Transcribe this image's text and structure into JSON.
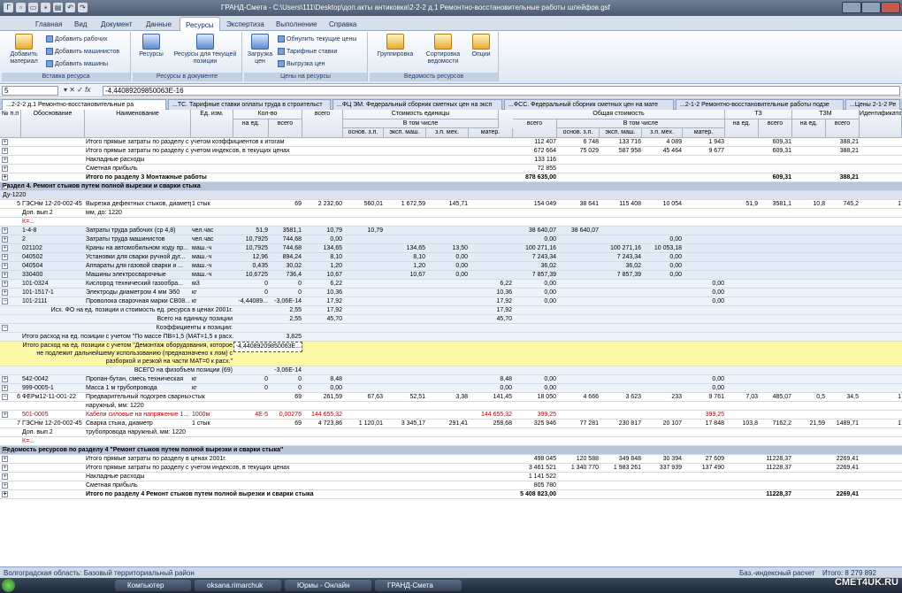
{
  "app": {
    "title": "ГРАНД-Смета - C:\\Users\\111\\Desktop\\доп.акты антиковка\\2-2-2 д.1 Ремонтно-восстановительные работы шлейфов.gsf"
  },
  "menu": [
    "Главная",
    "Вид",
    "Документ",
    "Данные",
    "Ресурсы",
    "Экспертиза",
    "Выполнение",
    "Справка"
  ],
  "ribbon": {
    "add_material": "Добавить материал",
    "add_workers": "Добавить рабочих",
    "add_machinists": "Добавить машинистов",
    "add_machines": "Добавить машины",
    "resources": "Ресурсы",
    "resources_current": "Ресурсы для текущей позиции",
    "load_prices": "Загрузка цен",
    "reset_prices": "Обнулить текущие цены",
    "tariff_rates": "Тарифные ставки",
    "unload_prices": "Выгрузка цен",
    "grouping": "Группировка",
    "sort_list": "Сортировка ведомости",
    "options": "Опции",
    "groups": [
      "Вставка ресурса",
      "Ресурсы в документе",
      "Цены на ресурсы",
      "Ведомость ресурсов"
    ]
  },
  "formula": {
    "cell": "5",
    "value": "-4,44089209850063E-16"
  },
  "tabs": [
    "...2-2-2 д.1 Ремонтно-восстановительные ра",
    "...ТС. Тарифные ставки оплаты труда в строительст",
    "...ФЦ ЭМ. Федеральный сборник сметных цен на эксп",
    "...ФСС. Федеральный сборник сметных цен на мате",
    "...2-1-2 Ремонтно-восстановительные работы подзе",
    "...Цены 2-1-2 Ре"
  ],
  "headers": {
    "num": "№ п.п",
    "basis": "Обоснование",
    "name": "Наименование",
    "unit": "Ед. изм.",
    "qty": "Кол-во",
    "qty_unit": "на ед.",
    "qty_total": "всего",
    "unit_cost": "Стоимость единицы",
    "total_cost_left": "всего",
    "incl": "В том числе",
    "osn_zp": "основ. з.п.",
    "eksp": "эксп. маш.",
    "zp_mekh": "з.п. мех.",
    "mater": "матер.",
    "total_cost": "Общая стоимость",
    "tc_total": "всего",
    "tc_zp": "основ. з.п.",
    "tc_eksp": "эксп. маш.",
    "tc_zpm": "з.п. мех.",
    "tc_mat": "матер.",
    "tz": "ТЗ",
    "tz_unit": "на ед.",
    "tz_total": "всего",
    "tzm": "ТЗМ",
    "tzm_unit": "на ед.",
    "tzm_total": "всего",
    "ident": "Идентификатор"
  },
  "rows": [
    {
      "t": "",
      "tg": "+",
      "name": "Итого прямые затраты по разделу с учетом коэффициентов к итогам",
      "tc": "112 407",
      "z": "6 748",
      "e": "133 716",
      "zm": "4 089",
      "m": "1 943",
      "tzt": "609,31",
      "tzmt": "388,21"
    },
    {
      "t": "",
      "tg": "+",
      "name": "Итого прямые затраты по разделу с учетом индексов, в текущих ценах",
      "tc": "672 664",
      "z": "75 029",
      "e": "587 958",
      "zm": "45 464",
      "m": "9 677",
      "tzt": "609,31",
      "tzmt": "388,21"
    },
    {
      "t": "",
      "tg": "+",
      "name": "Накладные расходы",
      "tc": "133 116"
    },
    {
      "t": "",
      "tg": "+",
      "name": "Сметная прибыль",
      "tc": "72 855"
    },
    {
      "t": "bold",
      "tg": "+",
      "name": "Итого по разделу 3 Монтажные  работы",
      "tc": "878 635,00",
      "tzt": "609,31",
      "tzmt": "388,21"
    },
    {
      "t": "sec",
      "tg": "-",
      "name": "Раздел 4. Ремонт стыков  путем полной вырезки и сварки стыка"
    },
    {
      "t": "sub",
      "name": "Ду-1220"
    },
    {
      "t": "",
      "num": "5",
      "basis": "ГЭСНм 12-20-002-45",
      "name": "Вырезка дефектных стыков, диаметр трубопровода наружный,",
      "unit": "1 стык",
      "qt": "69",
      "total": "2 232,60",
      "osn": "560,01",
      "eks": "1 672,59",
      "zm1": "145,71",
      "tc": "154 049",
      "z": "38 641",
      "e": "115 408",
      "zm": "10 054",
      "tzu": "51,9",
      "tzt": "3581,1",
      "tzmu": "10,8",
      "tzmt": "745,2",
      "id": "1"
    },
    {
      "t": "",
      "basis": "Доп. вып.2",
      "name": "мм, до: 1220"
    },
    {
      "t": "red",
      "basis": "К=..."
    },
    {
      "t": "blue",
      "tg": "+",
      "basis": "1-4-8",
      "name": "Затраты труда рабочих (ср 4,8)",
      "unit": "чел.час",
      "qu": "51,9",
      "qt": "3581,1",
      "total": "10,79",
      "osn": "10,79",
      "tc": "38 640,07",
      "z": "38 640,07"
    },
    {
      "t": "blue",
      "tg": "+",
      "basis": "2",
      "name": "Затраты труда машинистов",
      "unit": "чел.час",
      "qu": "10,7925",
      "qt": "744,68",
      "total": "0,00",
      "tc": "0,00",
      "zm": "0,00"
    },
    {
      "t": "blue",
      "tg": "+",
      "basis": "021102",
      "name": "Краны на автомобильном ходу пр...",
      "unit": "маш.-ч",
      "qu": "10,7925",
      "qt": "744,68",
      "total": "134,65",
      "eks": "134,65",
      "zm1": "13,50",
      "tc": "100 271,16",
      "e": "100 271,16",
      "zm": "10 053,18"
    },
    {
      "t": "blue",
      "tg": "+",
      "basis": "040502",
      "name": "Установки для сварки ручной дуг...",
      "unit": "маш.-ч",
      "qu": "12,96",
      "qt": "894,24",
      "total": "8,10",
      "eks": "8,10",
      "zm1": "0,00",
      "tc": "7 243,34",
      "e": "7 243,34",
      "zm": "0,00"
    },
    {
      "t": "blue",
      "tg": "+",
      "basis": "040504",
      "name": "Аппараты для газовой сварки и ...",
      "unit": "маш.-ч",
      "qu": "0,435",
      "qt": "30,02",
      "total": "1,20",
      "eks": "1,20",
      "zm1": "0,00",
      "tc": "36,02",
      "e": "36,02",
      "zm": "0,00"
    },
    {
      "t": "blue",
      "tg": "+",
      "basis": "330400",
      "name": "Машины электросварочные",
      "unit": "маш.-ч",
      "qu": "10,6725",
      "qt": "736,4",
      "total": "10,67",
      "eks": "10,67",
      "zm1": "0,00",
      "tc": "7 857,39",
      "e": "7 857,39",
      "zm": "0,00"
    },
    {
      "t": "lb",
      "tg": "+",
      "basis": "101-0324",
      "name": "Кислород технический газообра...",
      "unit": "м3",
      "qu": "0",
      "qt": "0",
      "total": "6,22",
      "m1": "6,22",
      "tc": "0,00",
      "m": "0,00"
    },
    {
      "t": "lb",
      "tg": "+",
      "basis": "101-1517-1",
      "name": "Электроды диаметром 4 мм Э50",
      "unit": "кг",
      "qu": "0",
      "qt": "0",
      "total": "10,36",
      "m1": "10,36",
      "tc": "0,00",
      "m": "0,00"
    },
    {
      "t": "lb",
      "tg": "-",
      "basis": "101-2111",
      "name": "Проволока сварочная марки СВ08...",
      "unit": "кг",
      "qu": "-4,44089...",
      "qt": "-3,06E-14",
      "total": "17,92",
      "m1": "17,92",
      "tc": "0,00",
      "m": "0,00"
    },
    {
      "t": "lb",
      "basis": "Исх. ФО на ед. позиции и стоимость ед. ресурса в ценах 2001г.",
      "qt": "2,55",
      "total": "17,92",
      "m1": "17,92"
    },
    {
      "t": "lb",
      "name": "Всего на единицу позиции",
      "qt": "2,55",
      "total": "45,70",
      "m1": "45,70"
    },
    {
      "t": "lb",
      "tg": "-",
      "name": "Коэффициенты к позиции:"
    },
    {
      "t": "lb",
      "name": "Итого расход на ед. позиции с учетом \"По массе ПВ=1,5 (МАТ=1,5 к расх.)\"",
      "qt": "3,825"
    },
    {
      "t": "yellow",
      "name": "Итого расход на ед. позиции с учетом \"Демонтаж оборудования, которое не подлежит дальнейшему использованию (предназначено к лом) с разборкой и резкой на части МАТ=0 к расх.\"",
      "qu": "-4,44089209850063E..."
    },
    {
      "t": "lb",
      "name": "ВСЕГО на физобъем позиции (69)",
      "qt": "-3,06E-14"
    },
    {
      "t": "lb",
      "tg": "+",
      "basis": "542-0042",
      "name": "Пропан-бутан, смесь техническая",
      "unit": "кг",
      "qu": "0",
      "qt": "0",
      "total": "8,48",
      "m1": "8,48",
      "tc": "0,00",
      "m": "0,00"
    },
    {
      "t": "lb",
      "tg": "+",
      "basis": "999-0005-1",
      "name": "Масса 1 м трубопровода",
      "unit": "кг",
      "qu": "0",
      "qt": "0",
      "total": "0,00",
      "m1": "0,00",
      "tc": "0,00",
      "m": "0,00"
    },
    {
      "t": "",
      "tg": "-",
      "num": "6",
      "basis": "ФЕРм12-11-001-22",
      "name": "Предварительный подогрев сварных соединений труб. Диаметр",
      "unit": "стык",
      "qt": "69",
      "total": "261,59",
      "osn": "67,63",
      "eks": "52,51",
      "zm1": "3,38",
      "m1": "141,45",
      "tc": "18 050",
      "z": "4 666",
      "e": "3 623",
      "zm": "233",
      "m": "9 761",
      "tzu": "7,03",
      "tzt": "485,07",
      "tzmu": "0,5",
      "tzmt": "34,5",
      "id": "1"
    },
    {
      "t": "",
      "name": "наружный, мм: 1220"
    },
    {
      "t": "red",
      "tg": "+",
      "basis": "501-0005",
      "name": "Кабели силовые на напряжение 1...",
      "unit": "1000м",
      "qu": "4E-5",
      "qt": "0,00276",
      "total": "144 655,32",
      "m1": "144 655,32",
      "tc": "399,25",
      "m": "399,25"
    },
    {
      "t": "",
      "num": "7",
      "basis": "ГЭСНм 12-20-002-45",
      "name": "Сварка стыка, диаметр",
      "unit": "1 стык",
      "qt": "69",
      "total": "4 723,86",
      "osn": "1 120,01",
      "eks": "3 345,17",
      "zm1": "291,41",
      "m1": "258,68",
      "tc": "325 946",
      "z": "77 281",
      "e": "230 817",
      "zm": "20 107",
      "m": "17 848",
      "tzu": "103,8",
      "tzt": "7162,2",
      "tzmu": "21,59",
      "tzmt": "1489,71",
      "id": "1"
    },
    {
      "t": "",
      "basis": "Доп. вып.2",
      "name": "трубопровода наружный, мм: 1220"
    },
    {
      "t": "red",
      "basis": "К=..."
    },
    {
      "t": "sec",
      "tg": "-",
      "name": "Ведомость ресурсов по разделу 4 \"Ремонт стыков  путем полной вырезки и сварки стыка\""
    },
    {
      "t": "",
      "tg": "+",
      "name": "Итого прямые затраты по разделу в ценах 2001г.",
      "tc": "498 045",
      "z": "120 588",
      "e": "349 848",
      "zm": "30 394",
      "m": "27 609",
      "tzt": "11228,37",
      "tzmt": "2269,41"
    },
    {
      "t": "",
      "tg": "+",
      "name": "Итого прямые затраты по разделу с учетом индексов, в текущих ценах",
      "tc": "3 461 521",
      "z": "1 340 770",
      "e": "1 983 261",
      "zm": "337 939",
      "m": "137 490",
      "tzt": "11228,37",
      "tzmt": "2269,41"
    },
    {
      "t": "",
      "tg": "+",
      "name": "Накладные расходы",
      "tc": "1 141 522"
    },
    {
      "t": "",
      "tg": "+",
      "name": "Сметная прибыль",
      "tc": "805 780"
    },
    {
      "t": "bold",
      "tg": "+",
      "name": "Итого по разделу 4 Ремонт стыков  путем полной вырезки и сварки стыка",
      "tc": "5 408 823,00",
      "tzt": "11228,37",
      "tzmt": "2269,41"
    }
  ],
  "status": {
    "region": "Волгоградская область:  Базовый территориальный район",
    "mode": "Баз.-индексный расчет",
    "total": "Итого: 8 279 892"
  },
  "taskbar": [
    "Компьютер",
    "oksana.rimarchuk",
    "Юрмы - Онлайн",
    "ГРАНД-Смета"
  ],
  "watermark": "СМЕТ4UK.RU"
}
